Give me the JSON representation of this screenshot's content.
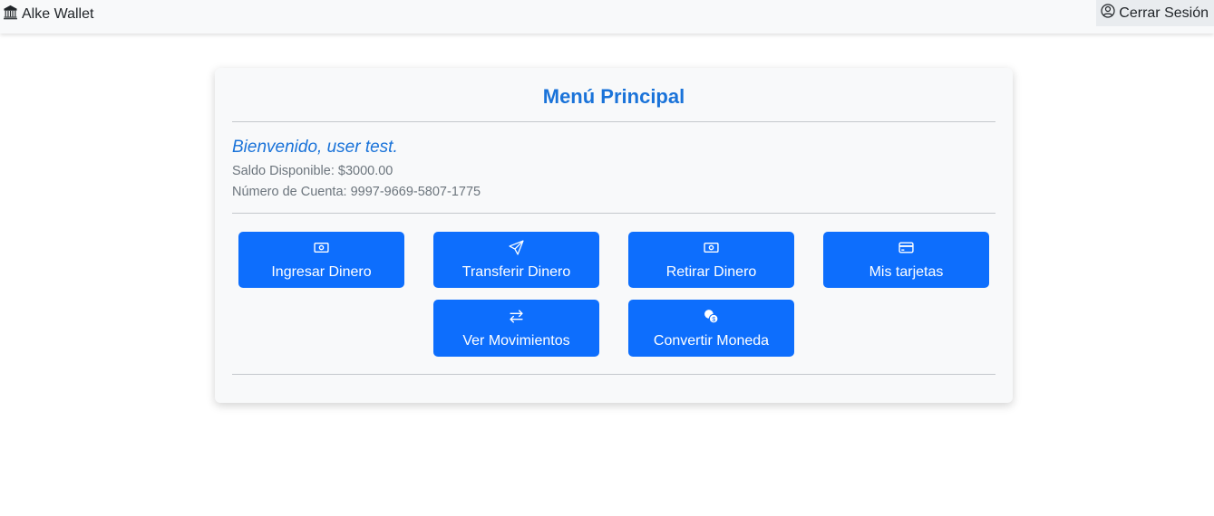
{
  "navbar": {
    "brand_label": "Alke Wallet",
    "brand_icon": "bank-icon",
    "logout_label": "Cerrar Sesión",
    "logout_icon": "person-circle-icon"
  },
  "card": {
    "title": "Menú Principal",
    "welcome": "Bienvenido, user test.",
    "balance": "Saldo Disponible: $3000.00",
    "account": "Número de Cuenta: 9997-9669-5807-1775"
  },
  "actions": [
    {
      "label": "Ingresar Dinero",
      "icon": "cash-icon"
    },
    {
      "label": "Transferir Dinero",
      "icon": "send-icon"
    },
    {
      "label": "Retirar Dinero",
      "icon": "cash-icon"
    },
    {
      "label": "Mis tarjetas",
      "icon": "credit-card-icon"
    },
    {
      "label": "Ver Movimientos",
      "icon": "arrow-left-right-icon"
    },
    {
      "label": "Convertir Moneda",
      "icon": "currency-exchange-icon"
    }
  ],
  "colors": {
    "primary": "#0d6efd",
    "heading": "#1a73d9",
    "muted": "#6c757d",
    "card_bg": "#f8f9fa"
  }
}
